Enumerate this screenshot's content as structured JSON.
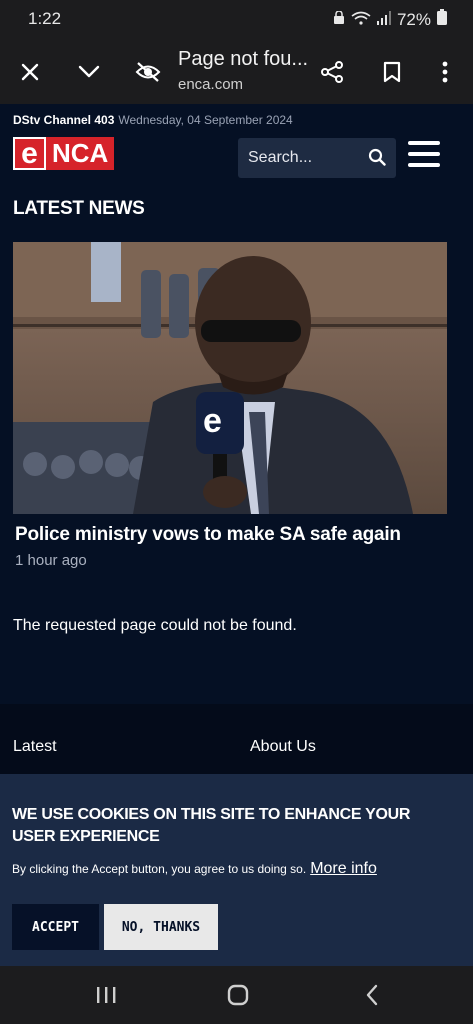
{
  "status": {
    "time": "1:22",
    "battery": "72%"
  },
  "browser": {
    "title": "Page not fou...",
    "url": "enca.com"
  },
  "header": {
    "channel": "DStv Channel 403",
    "date": "Wednesday, 04 September 2024",
    "logo_e": "e",
    "logo_text": "NCA",
    "search_placeholder": "Search..."
  },
  "section": {
    "title": "LATEST NEWS"
  },
  "article": {
    "headline": "Police ministry vows to make SA safe again",
    "time": "1 hour ago"
  },
  "message": "The requested page could not be found.",
  "footer": {
    "links": [
      "Latest",
      "About Us"
    ]
  },
  "cookie": {
    "title": "WE USE COOKIES ON THIS SITE TO ENHANCE YOUR USER EXPERIENCE",
    "text": "By clicking the Accept button, you agree to us doing so.",
    "more_info": "More info",
    "accept": "ACCEPT",
    "decline": "NO, THANKS"
  },
  "colors": {
    "brand_red": "#d6232a",
    "page_bg": "#051024",
    "cookie_bg": "#1b2a45"
  },
  "icons": [
    "close-icon",
    "chevron-down-icon",
    "eye-off-icon",
    "share-icon",
    "bookmark-icon",
    "more-vert-icon",
    "search-icon",
    "menu-icon",
    "recents-icon",
    "home-icon",
    "back-icon"
  ]
}
